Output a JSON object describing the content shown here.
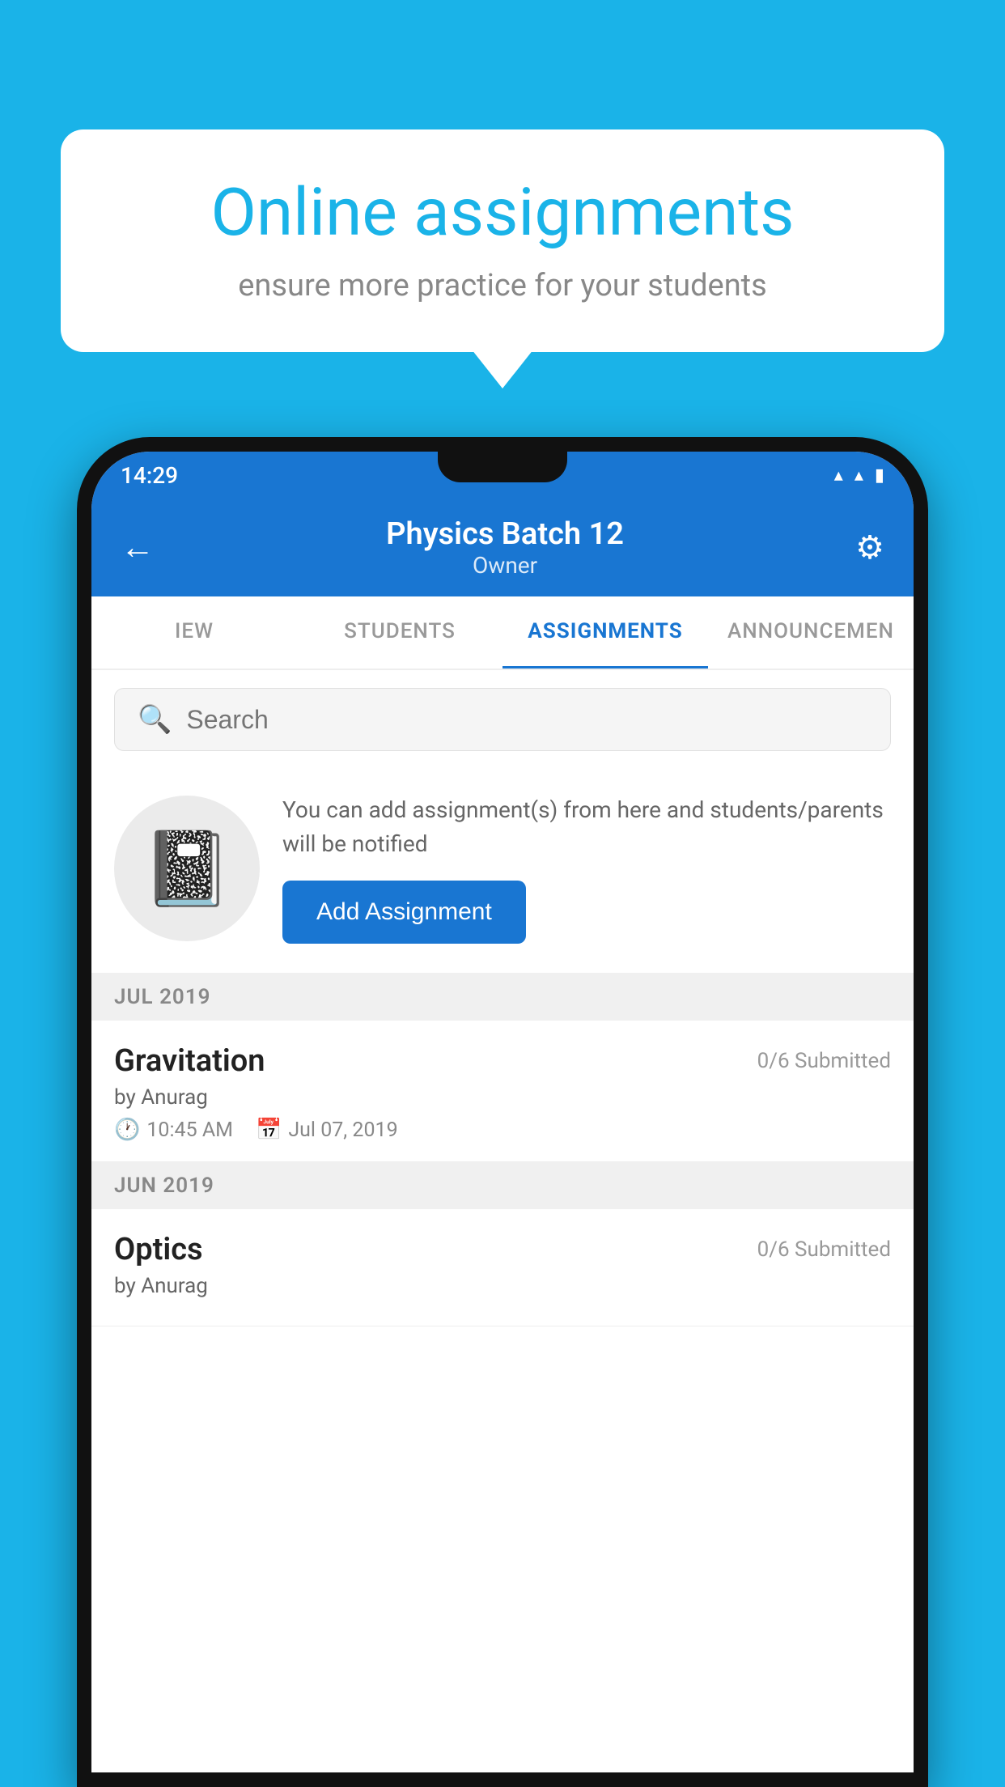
{
  "background_color": "#1ab3e8",
  "speech_bubble": {
    "title": "Online assignments",
    "subtitle": "ensure more practice for your students"
  },
  "status_bar": {
    "time": "14:29",
    "wifi": "▼",
    "signal": "▲",
    "battery": "▮"
  },
  "header": {
    "title": "Physics Batch 12",
    "subtitle": "Owner",
    "back_label": "←",
    "settings_label": "⚙"
  },
  "tabs": [
    {
      "label": "IEW",
      "active": false
    },
    {
      "label": "STUDENTS",
      "active": false
    },
    {
      "label": "ASSIGNMENTS",
      "active": true
    },
    {
      "label": "ANNOUNCEMENTS",
      "active": false
    }
  ],
  "search": {
    "placeholder": "Search"
  },
  "add_section": {
    "description": "You can add assignment(s) from here and students/parents will be notified",
    "button_label": "Add Assignment"
  },
  "sections": [
    {
      "month": "JUL 2019",
      "assignments": [
        {
          "name": "Gravitation",
          "submitted": "0/6 Submitted",
          "by": "by Anurag",
          "time": "10:45 AM",
          "date": "Jul 07, 2019"
        }
      ]
    },
    {
      "month": "JUN 2019",
      "assignments": [
        {
          "name": "Optics",
          "submitted": "0/6 Submitted",
          "by": "by Anurag",
          "time": "",
          "date": ""
        }
      ]
    }
  ]
}
